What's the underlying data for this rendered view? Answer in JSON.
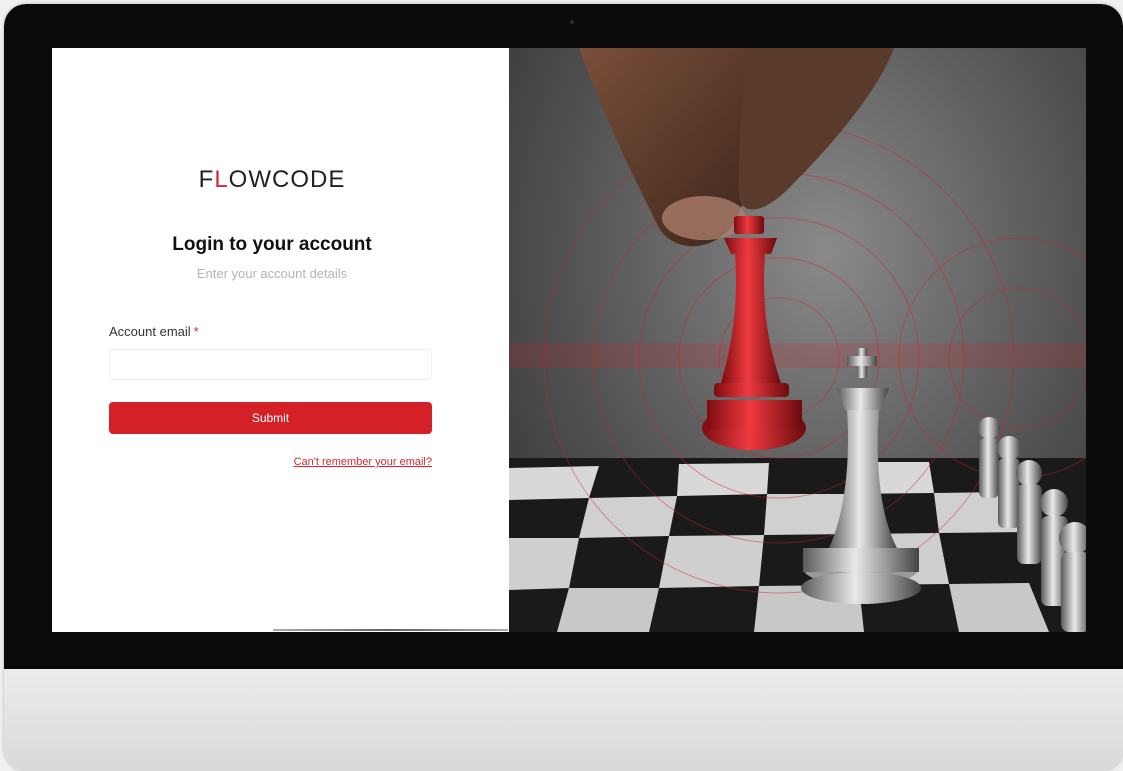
{
  "logo": {
    "text_first": "F",
    "text_accent": "L",
    "text_rest": "OWCODE"
  },
  "login": {
    "title": "Login to your account",
    "subtitle": "Enter your account details",
    "email_label": "Account email",
    "required_mark": "*",
    "email_value": "",
    "submit_label": "Submit",
    "forgot_link": "Can't remember your email?"
  },
  "hero": {
    "subject": "chess-king-photo",
    "accent_color": "#d42027"
  },
  "colors": {
    "brand_red": "#d42027",
    "text_dark": "#111111",
    "muted": "#b5b5b5"
  }
}
